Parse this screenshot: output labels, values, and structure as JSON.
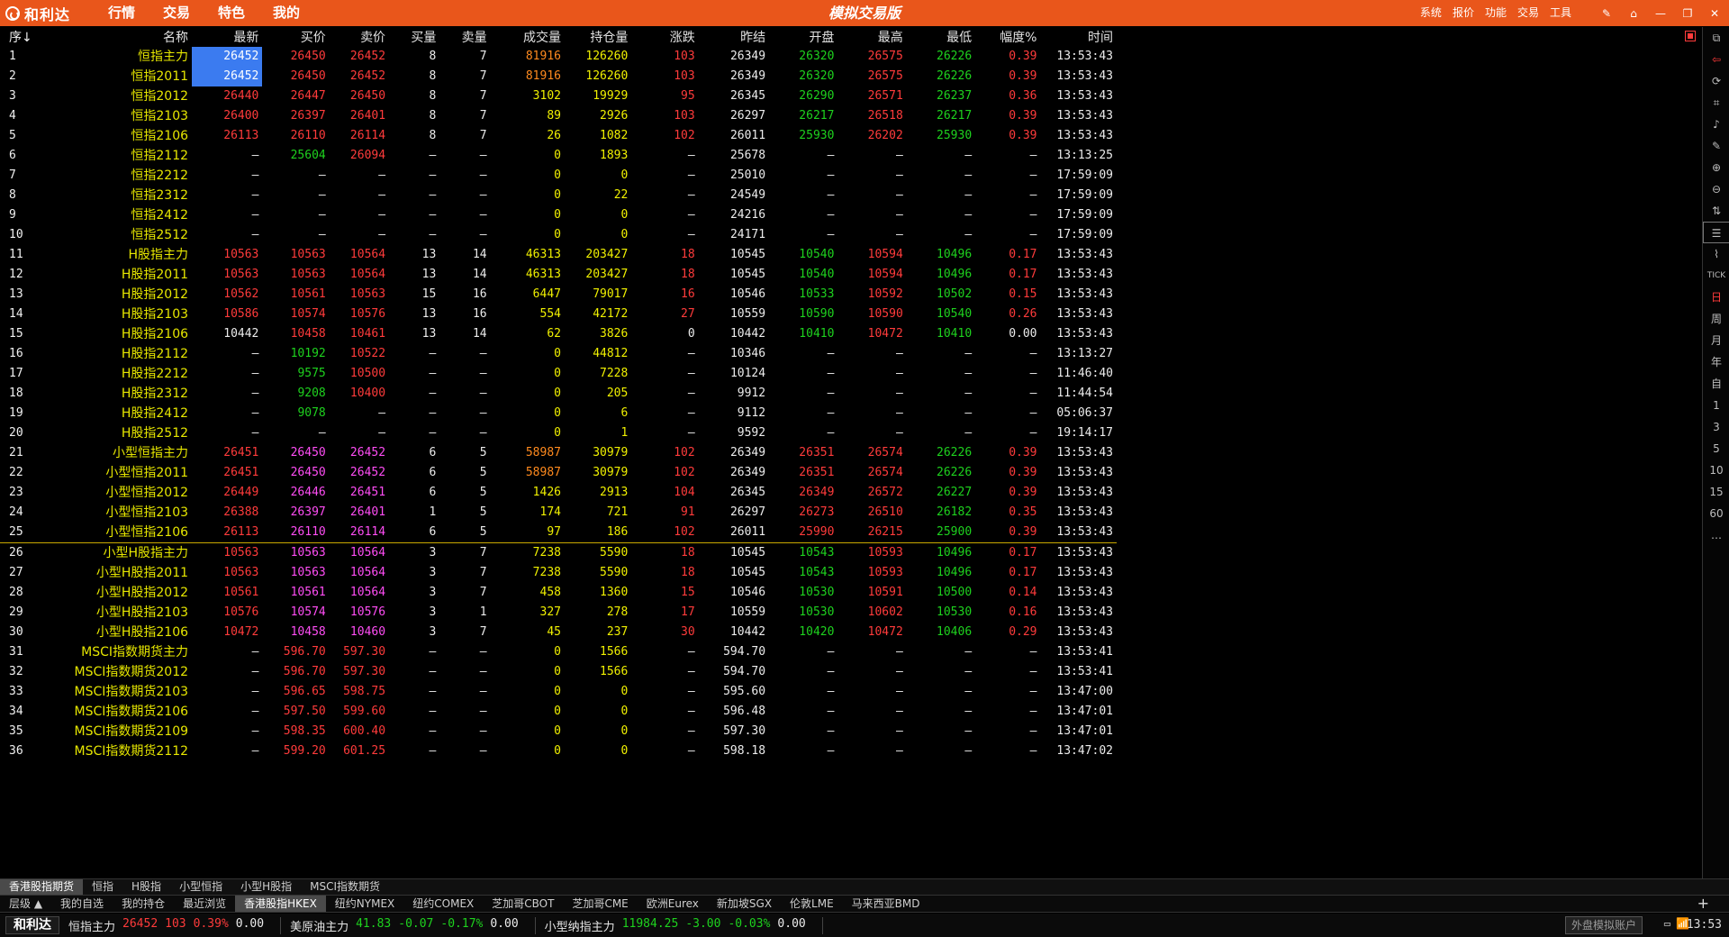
{
  "titlebar": {
    "logo_text": "和利达",
    "app_title": "模拟交易版",
    "main_menu": [
      "行情",
      "交易",
      "特色",
      "我的"
    ],
    "right_menu": [
      "系统",
      "报价",
      "功能",
      "交易",
      "工具"
    ]
  },
  "table": {
    "headers": [
      "序↓",
      "名称",
      "最新",
      "买价",
      "卖价",
      "买量",
      "卖量",
      "成交量",
      "持仓量",
      "涨跌",
      "昨结",
      "开盘",
      "最高",
      "最低",
      "幅度%",
      "时间"
    ],
    "rows": [
      [
        "1",
        "恒指主力",
        "26452",
        "26450",
        "26452",
        "8",
        "7",
        "81916",
        "126260",
        "103",
        "26349",
        "26320",
        "26575",
        "26226",
        "0.39",
        "13:53:43"
      ],
      [
        "2",
        "恒指2011",
        "26452",
        "26450",
        "26452",
        "8",
        "7",
        "81916",
        "126260",
        "103",
        "26349",
        "26320",
        "26575",
        "26226",
        "0.39",
        "13:53:43"
      ],
      [
        "3",
        "恒指2012",
        "26440",
        "26447",
        "26450",
        "8",
        "7",
        "3102",
        "19929",
        "95",
        "26345",
        "26290",
        "26571",
        "26237",
        "0.36",
        "13:53:43"
      ],
      [
        "4",
        "恒指2103",
        "26400",
        "26397",
        "26401",
        "8",
        "7",
        "89",
        "2926",
        "103",
        "26297",
        "26217",
        "26518",
        "26217",
        "0.39",
        "13:53:43"
      ],
      [
        "5",
        "恒指2106",
        "26113",
        "26110",
        "26114",
        "8",
        "7",
        "26",
        "1082",
        "102",
        "26011",
        "25930",
        "26202",
        "25930",
        "0.39",
        "13:53:43"
      ],
      [
        "6",
        "恒指2112",
        "–",
        "25604",
        "26094",
        "–",
        "–",
        "0",
        "1893",
        "–",
        "25678",
        "–",
        "–",
        "–",
        "–",
        "13:13:25"
      ],
      [
        "7",
        "恒指2212",
        "–",
        "–",
        "–",
        "–",
        "–",
        "0",
        "0",
        "–",
        "25010",
        "–",
        "–",
        "–",
        "–",
        "17:59:09"
      ],
      [
        "8",
        "恒指2312",
        "–",
        "–",
        "–",
        "–",
        "–",
        "0",
        "22",
        "–",
        "24549",
        "–",
        "–",
        "–",
        "–",
        "17:59:09"
      ],
      [
        "9",
        "恒指2412",
        "–",
        "–",
        "–",
        "–",
        "–",
        "0",
        "0",
        "–",
        "24216",
        "–",
        "–",
        "–",
        "–",
        "17:59:09"
      ],
      [
        "10",
        "恒指2512",
        "–",
        "–",
        "–",
        "–",
        "–",
        "0",
        "0",
        "–",
        "24171",
        "–",
        "–",
        "–",
        "–",
        "17:59:09"
      ],
      [
        "11",
        "H股指主力",
        "10563",
        "10563",
        "10564",
        "13",
        "14",
        "46313",
        "203427",
        "18",
        "10545",
        "10540",
        "10594",
        "10496",
        "0.17",
        "13:53:43"
      ],
      [
        "12",
        "H股指2011",
        "10563",
        "10563",
        "10564",
        "13",
        "14",
        "46313",
        "203427",
        "18",
        "10545",
        "10540",
        "10594",
        "10496",
        "0.17",
        "13:53:43"
      ],
      [
        "13",
        "H股指2012",
        "10562",
        "10561",
        "10563",
        "15",
        "16",
        "6447",
        "79017",
        "16",
        "10546",
        "10533",
        "10592",
        "10502",
        "0.15",
        "13:53:43"
      ],
      [
        "14",
        "H股指2103",
        "10586",
        "10574",
        "10576",
        "13",
        "16",
        "554",
        "42172",
        "27",
        "10559",
        "10590",
        "10590",
        "10540",
        "0.26",
        "13:53:43"
      ],
      [
        "15",
        "H股指2106",
        "10442",
        "10458",
        "10461",
        "13",
        "14",
        "62",
        "3826",
        "0",
        "10442",
        "10410",
        "10472",
        "10410",
        "0.00",
        "13:53:43"
      ],
      [
        "16",
        "H股指2112",
        "–",
        "10192",
        "10522",
        "–",
        "–",
        "0",
        "44812",
        "–",
        "10346",
        "–",
        "–",
        "–",
        "–",
        "13:13:27"
      ],
      [
        "17",
        "H股指2212",
        "–",
        "9575",
        "10500",
        "–",
        "–",
        "0",
        "7228",
        "–",
        "10124",
        "–",
        "–",
        "–",
        "–",
        "11:46:40"
      ],
      [
        "18",
        "H股指2312",
        "–",
        "9208",
        "10400",
        "–",
        "–",
        "0",
        "205",
        "–",
        "9912",
        "–",
        "–",
        "–",
        "–",
        "11:44:54"
      ],
      [
        "19",
        "H股指2412",
        "–",
        "9078",
        "–",
        "–",
        "–",
        "0",
        "6",
        "–",
        "9112",
        "–",
        "–",
        "–",
        "–",
        "05:06:37"
      ],
      [
        "20",
        "H股指2512",
        "–",
        "–",
        "–",
        "–",
        "–",
        "0",
        "1",
        "–",
        "9592",
        "–",
        "–",
        "–",
        "–",
        "19:14:17"
      ],
      [
        "21",
        "小型恒指主力",
        "26451",
        "26450",
        "26452",
        "6",
        "5",
        "58987",
        "30979",
        "102",
        "26349",
        "26351",
        "26574",
        "26226",
        "0.39",
        "13:53:43"
      ],
      [
        "22",
        "小型恒指2011",
        "26451",
        "26450",
        "26452",
        "6",
        "5",
        "58987",
        "30979",
        "102",
        "26349",
        "26351",
        "26574",
        "26226",
        "0.39",
        "13:53:43"
      ],
      [
        "23",
        "小型恒指2012",
        "26449",
        "26446",
        "26451",
        "6",
        "5",
        "1426",
        "2913",
        "104",
        "26345",
        "26349",
        "26572",
        "26227",
        "0.39",
        "13:53:43"
      ],
      [
        "24",
        "小型恒指2103",
        "26388",
        "26397",
        "26401",
        "1",
        "5",
        "174",
        "721",
        "91",
        "26297",
        "26273",
        "26510",
        "26182",
        "0.35",
        "13:53:43"
      ],
      [
        "25",
        "小型恒指2106",
        "26113",
        "26110",
        "26114",
        "6",
        "5",
        "97",
        "186",
        "102",
        "26011",
        "25990",
        "26215",
        "25900",
        "0.39",
        "13:53:43"
      ],
      [
        "26",
        "小型H股指主力",
        "10563",
        "10563",
        "10564",
        "3",
        "7",
        "7238",
        "5590",
        "18",
        "10545",
        "10543",
        "10593",
        "10496",
        "0.17",
        "13:53:43"
      ],
      [
        "27",
        "小型H股指2011",
        "10563",
        "10563",
        "10564",
        "3",
        "7",
        "7238",
        "5590",
        "18",
        "10545",
        "10543",
        "10593",
        "10496",
        "0.17",
        "13:53:43"
      ],
      [
        "28",
        "小型H股指2012",
        "10561",
        "10561",
        "10564",
        "3",
        "7",
        "458",
        "1360",
        "15",
        "10546",
        "10530",
        "10591",
        "10500",
        "0.14",
        "13:53:43"
      ],
      [
        "29",
        "小型H股指2103",
        "10576",
        "10574",
        "10576",
        "3",
        "1",
        "327",
        "278",
        "17",
        "10559",
        "10530",
        "10602",
        "10530",
        "0.16",
        "13:53:43"
      ],
      [
        "30",
        "小型H股指2106",
        "10472",
        "10458",
        "10460",
        "3",
        "7",
        "45",
        "237",
        "30",
        "10442",
        "10420",
        "10472",
        "10406",
        "0.29",
        "13:53:43"
      ],
      [
        "31",
        "MSCI指数期货主力",
        "–",
        "596.70",
        "597.30",
        "–",
        "–",
        "0",
        "1566",
        "–",
        "594.70",
        "–",
        "–",
        "–",
        "–",
        "13:53:41"
      ],
      [
        "32",
        "MSCI指数期货2012",
        "–",
        "596.70",
        "597.30",
        "–",
        "–",
        "0",
        "1566",
        "–",
        "594.70",
        "–",
        "–",
        "–",
        "–",
        "13:53:41"
      ],
      [
        "33",
        "MSCI指数期货2103",
        "–",
        "596.65",
        "598.75",
        "–",
        "–",
        "0",
        "0",
        "–",
        "595.60",
        "–",
        "–",
        "–",
        "–",
        "13:47:00"
      ],
      [
        "34",
        "MSCI指数期货2106",
        "–",
        "597.50",
        "599.60",
        "–",
        "–",
        "0",
        "0",
        "–",
        "596.48",
        "–",
        "–",
        "–",
        "–",
        "13:47:01"
      ],
      [
        "35",
        "MSCI指数期货2109",
        "–",
        "598.35",
        "600.40",
        "–",
        "–",
        "0",
        "0",
        "–",
        "597.30",
        "–",
        "–",
        "–",
        "–",
        "13:47:01"
      ],
      [
        "36",
        "MSCI指数期货2112",
        "–",
        "599.20",
        "601.25",
        "–",
        "–",
        "0",
        "0",
        "–",
        "598.18",
        "–",
        "–",
        "–",
        "–",
        "13:47:02"
      ]
    ]
  },
  "right_toolbar": [
    "TICK",
    "日",
    "周",
    "月",
    "年",
    "自",
    "1",
    "3",
    "5",
    "10",
    "15",
    "60",
    "…"
  ],
  "tabs_category": [
    "香港股指期货",
    "恒指",
    "H股指",
    "小型恒指",
    "小型H股指",
    "MSCI指数期货"
  ],
  "tabs_category_active": 0,
  "tabs_market": [
    "层级 ▲",
    "我的自选",
    "我的持仓",
    "最近浏览",
    "香港股指HKEX",
    "纽约NYMEX",
    "纽约COMEX",
    "芝加哥CBOT",
    "芝加哥CME",
    "欧洲Eurex",
    "新加坡SGX",
    "伦敦LME",
    "马来西亚BMD"
  ],
  "tabs_market_active": 4,
  "statusbar": {
    "logo": "和利达",
    "tickers": [
      {
        "name": "恒指主力",
        "price": "26452",
        "chg": "103",
        "pct": "0.39%",
        "vol": "0.00",
        "dir": "up"
      },
      {
        "name": "美原油主力",
        "price": "41.83",
        "chg": "-0.07",
        "pct": "-0.17%",
        "vol": "0.00",
        "dir": "dn"
      },
      {
        "name": "小型纳指主力",
        "price": "11984.25",
        "chg": "-3.00",
        "pct": "-0.03%",
        "vol": "0.00",
        "dir": "dn"
      }
    ],
    "account_label": "外盘模拟账户",
    "time": "13:53"
  },
  "colors": {
    "accent": "#e9561b",
    "up": "#ff3b3b",
    "down": "#1ed21e",
    "name": "#e6e600",
    "volume": "#f0f000",
    "selected": "#3b7bf0"
  }
}
